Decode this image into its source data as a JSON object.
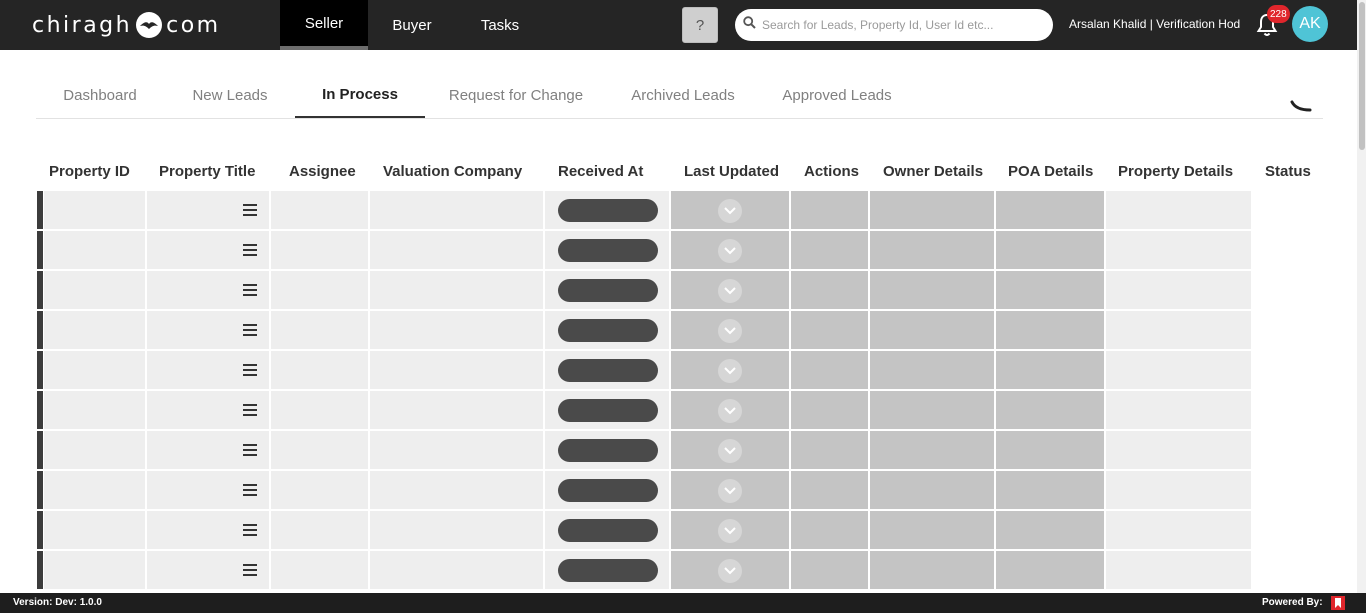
{
  "app": {
    "logo_left": "chiragh",
    "logo_right": "com",
    "logo_icon": "bird-logo-icon"
  },
  "topnav": {
    "tabs": [
      {
        "label": "Seller",
        "active": true
      },
      {
        "label": "Buyer",
        "active": false
      },
      {
        "label": "Tasks",
        "active": false
      }
    ],
    "help_label": "?",
    "search_placeholder": "Search for Leads, Property Id, User Id etc...",
    "user_label": "Arsalan Khalid | Verification Hod",
    "notification_count": "228",
    "avatar_initials": "AK"
  },
  "subtabs": [
    {
      "label": "Dashboard",
      "active": false
    },
    {
      "label": "New Leads",
      "active": false
    },
    {
      "label": "In Process",
      "active": true
    },
    {
      "label": "Request for Change",
      "active": false
    },
    {
      "label": "Archived Leads",
      "active": false
    },
    {
      "label": "Approved Leads",
      "active": false
    }
  ],
  "table": {
    "columns": [
      "Property ID",
      "Property Title",
      "Assignee",
      "Valuation Company",
      "Received At",
      "Last Updated",
      "Actions",
      "Owner Details",
      "POA Details",
      "Property Details",
      "Status"
    ],
    "loading_rows": 10
  },
  "footer": {
    "version": "Version: Dev: 1.0.0",
    "powered_by": "Powered By:"
  },
  "colors": {
    "topbar": "#252525",
    "badge": "#e0262c",
    "avatar": "#4fc4d6",
    "skeleton_light": "#eeeeee",
    "skeleton_dark": "#c4c4c4",
    "skeleton_pill": "#4a4a4a"
  }
}
